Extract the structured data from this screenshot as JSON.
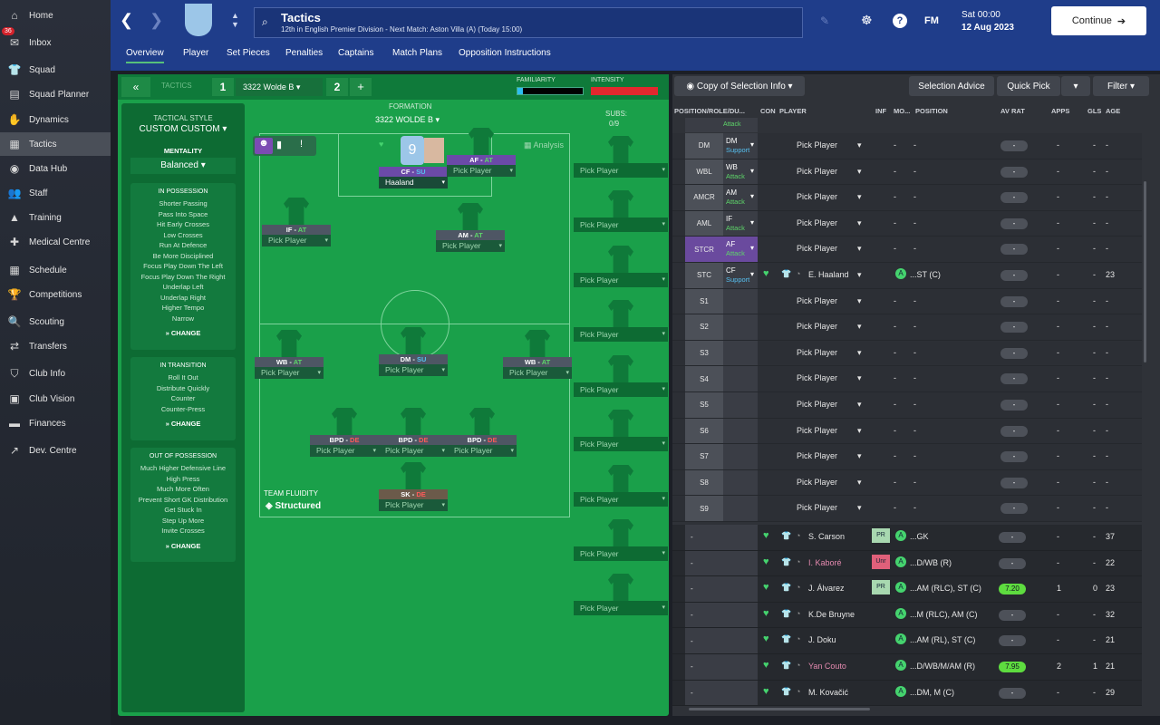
{
  "sidebar": {
    "items": [
      {
        "label": "Home",
        "icon": "home-icon"
      },
      {
        "label": "Inbox",
        "icon": "inbox-icon",
        "badge": "36"
      },
      {
        "label": "Squad",
        "icon": "squad-icon"
      },
      {
        "label": "Squad Planner",
        "icon": "planner-icon"
      },
      {
        "label": "Dynamics",
        "icon": "dynamics-icon"
      },
      {
        "label": "Tactics",
        "icon": "tactics-icon"
      },
      {
        "label": "Data Hub",
        "icon": "datahub-icon"
      },
      {
        "label": "Staff",
        "icon": "staff-icon"
      },
      {
        "label": "Training",
        "icon": "training-icon"
      },
      {
        "label": "Medical Centre",
        "icon": "medical-icon"
      },
      {
        "label": "Schedule",
        "icon": "schedule-icon"
      },
      {
        "label": "Competitions",
        "icon": "trophy-icon"
      },
      {
        "label": "Scouting",
        "icon": "scouting-icon"
      },
      {
        "label": "Transfers",
        "icon": "transfers-icon"
      },
      {
        "label": "Club Info",
        "icon": "shield-icon"
      },
      {
        "label": "Club Vision",
        "icon": "vision-icon"
      },
      {
        "label": "Finances",
        "icon": "finances-icon"
      },
      {
        "label": "Dev. Centre",
        "icon": "dev-icon"
      }
    ]
  },
  "header": {
    "title": "Tactics",
    "subtitle": "12th in English Premier Division - Next Match: Aston Villa (A) (Today 15:00)",
    "day": "Sat 00:00",
    "date": "12 Aug 2023",
    "continue": "Continue",
    "fm": "FM",
    "help": "?",
    "tabs": [
      "Overview",
      "Player",
      "Set Pieces",
      "Penalties",
      "Captains",
      "Match Plans",
      "Opposition Instructions"
    ]
  },
  "tacticbar": {
    "tactics_label": "TACTICS",
    "slot1": "1",
    "name": "3322 Wolde B",
    "slot2": "2",
    "add": "+",
    "familiarity": "FAMILIARITY",
    "intensity": "INTENSITY"
  },
  "style": {
    "heading": "TACTICAL STYLE",
    "style": "CUSTOM CUSTOM",
    "mentality_label": "MENTALITY",
    "mentality": "Balanced",
    "possession_head": "IN POSSESSION",
    "possession": [
      "Shorter Passing",
      "Pass Into Space",
      "Hit Early Crosses",
      "Low Crosses",
      "Run At Defence",
      "Be More Disciplined",
      "Focus Play Down The Left",
      "Focus Play Down The Right",
      "Underlap Left",
      "Underlap Right",
      "Higher Tempo",
      "Narrow"
    ],
    "transition_head": "IN TRANSITION",
    "transition": [
      "Roll It Out",
      "Distribute Quickly",
      "Counter",
      "Counter-Press"
    ],
    "oop_head": "OUT OF POSSESSION",
    "oop": [
      "Much Higher Defensive Line",
      "High Press",
      "Much More Often",
      "Prevent Short GK Distribution",
      "Get Stuck In",
      "Step Up More",
      "Invite Crosses"
    ],
    "change": "CHANGE"
  },
  "formation": {
    "label": "FORMATION",
    "name": "3322 WOLDE B",
    "subs_label": "SUBS:",
    "subs_count": "0/9",
    "analysis": "Analysis",
    "fluidity_label": "TEAM FLUIDITY",
    "fluidity": "Structured",
    "pick": "Pick Player",
    "positions": [
      {
        "pos": "CF",
        "duty": "SU",
        "player": "Haaland"
      },
      {
        "pos": "AF",
        "duty": "AT",
        "player": "Pick Player"
      },
      {
        "pos": "IF",
        "duty": "AT",
        "player": "Pick Player"
      },
      {
        "pos": "AM",
        "duty": "AT",
        "player": "Pick Player"
      },
      {
        "pos": "WB",
        "duty": "AT",
        "player": "Pick Player"
      },
      {
        "pos": "DM",
        "duty": "SU",
        "player": "Pick Player"
      },
      {
        "pos": "WB",
        "duty": "AT",
        "player": "Pick Player"
      },
      {
        "pos": "BPD",
        "duty": "DE",
        "player": "Pick Player"
      },
      {
        "pos": "BPD",
        "duty": "DE",
        "player": "Pick Player"
      },
      {
        "pos": "BPD",
        "duty": "DE",
        "player": "Pick Player"
      },
      {
        "pos": "SK",
        "duty": "DE",
        "player": "Pick Player"
      }
    ],
    "shirt_number": "9"
  },
  "right": {
    "copy_btn": "Copy of Selection Info",
    "advice": "Selection Advice",
    "quick": "Quick Pick",
    "filter": "Filter",
    "cols": [
      "POSITION/ROLE/DU...",
      "CON",
      "PLAYER",
      "INF",
      "MO...",
      "POSITION",
      "AV RAT",
      "APPS",
      "GLS",
      "AGE"
    ],
    "top_role": "Attack",
    "slots": [
      {
        "pos": "DM",
        "role": "DM",
        "duty": "Support",
        "player": "Pick Player",
        "c1": "-",
        "c2": "-",
        "apps": "-",
        "gls": "-",
        "age": "-"
      },
      {
        "pos": "WBL",
        "role": "WB",
        "duty": "Attack",
        "player": "Pick Player",
        "c1": "-",
        "c2": "-",
        "apps": "-",
        "gls": "-",
        "age": "-"
      },
      {
        "pos": "AMCR",
        "role": "AM",
        "duty": "Attack",
        "player": "Pick Player",
        "c1": "-",
        "c2": "-",
        "apps": "-",
        "gls": "-",
        "age": "-"
      },
      {
        "pos": "AML",
        "role": "IF",
        "duty": "Attack",
        "player": "Pick Player",
        "c1": "-",
        "c2": "-",
        "apps": "-",
        "gls": "-",
        "age": "-"
      },
      {
        "pos": "STCR",
        "role": "AF",
        "duty": "Attack",
        "player": "Pick Player",
        "c1": "-",
        "c2": "-",
        "apps": "-",
        "gls": "-",
        "age": "-"
      },
      {
        "pos": "STC",
        "role": "CF",
        "duty": "Support",
        "player": "E. Haaland",
        "c1": "A",
        "c2": "...ST (C)",
        "apps": "-",
        "gls": "-",
        "age": "23"
      },
      {
        "pos": "S1",
        "player": "Pick Player",
        "c1": "-",
        "c2": "-",
        "apps": "-",
        "gls": "-",
        "age": "-"
      },
      {
        "pos": "S2",
        "player": "Pick Player",
        "c1": "-",
        "c2": "-",
        "apps": "-",
        "gls": "-",
        "age": "-"
      },
      {
        "pos": "S3",
        "player": "Pick Player",
        "c1": "-",
        "c2": "-",
        "apps": "-",
        "gls": "-",
        "age": "-"
      },
      {
        "pos": "S4",
        "player": "Pick Player",
        "c1": "-",
        "c2": "-",
        "apps": "-",
        "gls": "-",
        "age": "-"
      },
      {
        "pos": "S5",
        "player": "Pick Player",
        "c1": "-",
        "c2": "-",
        "apps": "-",
        "gls": "-",
        "age": "-"
      },
      {
        "pos": "S6",
        "player": "Pick Player",
        "c1": "-",
        "c2": "-",
        "apps": "-",
        "gls": "-",
        "age": "-"
      },
      {
        "pos": "S7",
        "player": "Pick Player",
        "c1": "-",
        "c2": "-",
        "apps": "-",
        "gls": "-",
        "age": "-"
      },
      {
        "pos": "S8",
        "player": "Pick Player",
        "c1": "-",
        "c2": "-",
        "apps": "-",
        "gls": "-",
        "age": "-"
      },
      {
        "pos": "S9",
        "player": "Pick Player",
        "c1": "-",
        "c2": "-",
        "apps": "-",
        "gls": "-",
        "age": "-"
      }
    ],
    "players": [
      {
        "name": "S. Carson",
        "inf": "PR",
        "mo": "A",
        "pos": "...GK",
        "rat": "-",
        "apps": "-",
        "gls": "-",
        "age": "37"
      },
      {
        "name": "I. Kaboré",
        "inf": "Unr",
        "mo": "A",
        "pos": "...D/WB (R)",
        "rat": "-",
        "apps": "-",
        "gls": "-",
        "age": "22"
      },
      {
        "name": "J. Álvarez",
        "inf": "PR",
        "mo": "A",
        "pos": "...AM (RLC), ST (C)",
        "rat": "7.20",
        "apps": "1",
        "gls": "0",
        "age": "23"
      },
      {
        "name": "K.De Bruyne",
        "inf": "",
        "mo": "A",
        "pos": "...M (RLC), AM (C)",
        "rat": "-",
        "apps": "-",
        "gls": "-",
        "age": "32"
      },
      {
        "name": "J. Doku",
        "inf": "",
        "mo": "A",
        "pos": "...AM (RL), ST (C)",
        "rat": "-",
        "apps": "-",
        "gls": "-",
        "age": "21"
      },
      {
        "name": "Yan Couto",
        "inf": "",
        "mo": "A",
        "pos": "...D/WB/M/AM (R)",
        "rat": "7.95",
        "apps": "2",
        "gls": "1",
        "age": "21"
      },
      {
        "name": "M. Kovačić",
        "inf": "",
        "mo": "A",
        "pos": "...DM, M (C)",
        "rat": "-",
        "apps": "-",
        "gls": "-",
        "age": "29"
      }
    ]
  },
  "colors": {
    "accent": "#1f3d8a",
    "pitch": "#1aa04a",
    "heart": "#45d36e",
    "attack": "#5ed66a",
    "support": "#56c0f0"
  }
}
